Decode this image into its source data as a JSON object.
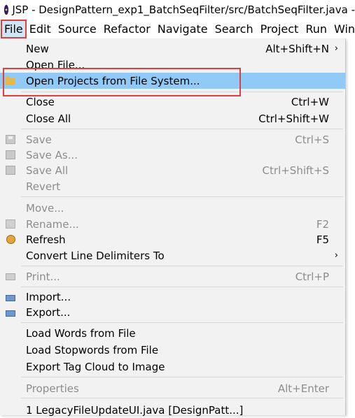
{
  "window": {
    "title": "JSP - DesignPattern_exp1_BatchSeqFilter/src/BatchSeqFilter.java -"
  },
  "menubar": [
    "File",
    "Edit",
    "Source",
    "Refactor",
    "Navigate",
    "Search",
    "Project",
    "Run",
    "Win"
  ],
  "menu": {
    "new": {
      "label": "New",
      "shortcut": "Alt+Shift+N"
    },
    "open_file": {
      "label": "Open File..."
    },
    "open_projects": {
      "label": "Open Projects from File System..."
    },
    "close": {
      "label": "Close",
      "shortcut": "Ctrl+W"
    },
    "close_all": {
      "label": "Close All",
      "shortcut": "Ctrl+Shift+W"
    },
    "save": {
      "label": "Save",
      "shortcut": "Ctrl+S"
    },
    "save_as": {
      "label": "Save As..."
    },
    "save_all": {
      "label": "Save All",
      "shortcut": "Ctrl+Shift+S"
    },
    "revert": {
      "label": "Revert"
    },
    "move": {
      "label": "Move..."
    },
    "rename": {
      "label": "Rename...",
      "shortcut": "F2"
    },
    "refresh": {
      "label": "Refresh",
      "shortcut": "F5"
    },
    "convert": {
      "label": "Convert Line Delimiters To"
    },
    "print": {
      "label": "Print...",
      "shortcut": "Ctrl+P"
    },
    "import": {
      "label": "Import..."
    },
    "export": {
      "label": "Export..."
    },
    "load_words": {
      "label": "Load Words from File"
    },
    "load_stopwords": {
      "label": "Load Stopwords from File"
    },
    "export_tag_cloud": {
      "label": "Export Tag Cloud to Image"
    },
    "properties": {
      "label": "Properties",
      "shortcut": "Alt+Enter"
    },
    "recent1": {
      "label": "1 LegacyFileUpdateUI.java  [DesignPatt...]"
    }
  },
  "colors": {
    "highlight": "#91c9f7",
    "annotation_box": "#e0403a",
    "menu_bg": "#f2f2f2"
  }
}
